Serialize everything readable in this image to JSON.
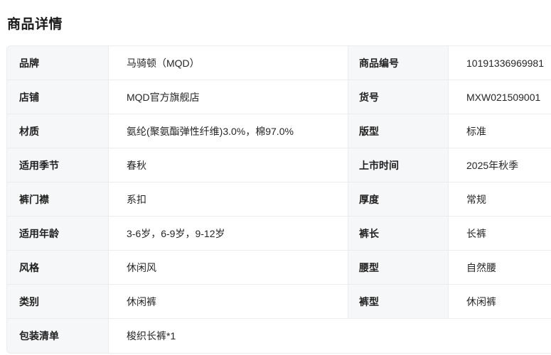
{
  "title": "商品详情",
  "rows": [
    {
      "l1": "品牌",
      "v1": "马骑顿（MQD）",
      "l2": "商品编号",
      "v2": "10191336969981"
    },
    {
      "l1": "店铺",
      "v1": "MQD官方旗舰店",
      "l2": "货号",
      "v2": "MXW021509001"
    },
    {
      "l1": "材质",
      "v1": "氨纶(聚氨酯弹性纤维)3.0%，棉97.0%",
      "l2": "版型",
      "v2": "标准"
    },
    {
      "l1": "适用季节",
      "v1": "春秋",
      "l2": "上市时间",
      "v2": "2025年秋季"
    },
    {
      "l1": "裤门襟",
      "v1": "系扣",
      "l2": "厚度",
      "v2": "常规"
    },
    {
      "l1": "适用年龄",
      "v1": "3-6岁，6-9岁，9-12岁",
      "l2": "裤长",
      "v2": "长裤"
    },
    {
      "l1": "风格",
      "v1": "休闲风",
      "l2": "腰型",
      "v2": "自然腰"
    },
    {
      "l1": "类别",
      "v1": "休闲裤",
      "l2": "裤型",
      "v2": "休闲裤"
    },
    {
      "l1": "包装清单",
      "v1": "梭织长裤*1"
    }
  ]
}
